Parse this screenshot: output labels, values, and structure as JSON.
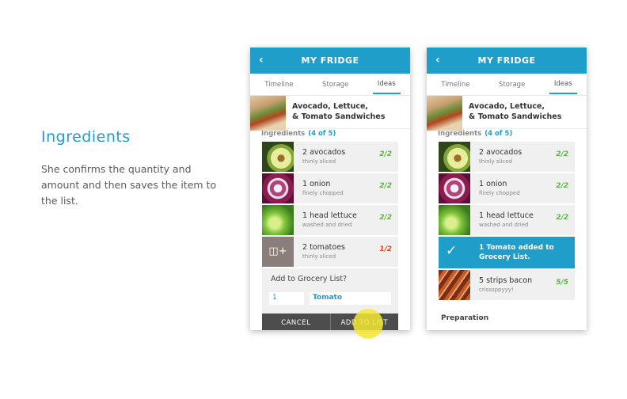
{
  "intro": {
    "title": "Ingredients",
    "description": "She confirms the quantity and amount and then saves the item to the list."
  },
  "app": {
    "title": "MY FRIDGE",
    "back_icon": "chevron-left-icon",
    "tabs": [
      "Timeline",
      "Storage",
      "Ideas"
    ],
    "active_tab": "Ideas",
    "recipe_title_line1": "Avocado, Lettuce,",
    "recipe_title_line2": "& Tomato Sandwiches",
    "ingredients_label": "Ingredients",
    "ingredients_count": "(4 of 5)"
  },
  "screen1": {
    "items": [
      {
        "name": "2 avocados",
        "sub": "thinly sliced",
        "frac": "2/2",
        "status": "full"
      },
      {
        "name": "1 onion",
        "sub": "finely chopped",
        "frac": "2/2",
        "status": "full"
      },
      {
        "name": "1 head lettuce",
        "sub": "washed and dried",
        "frac": "2/2",
        "status": "full"
      },
      {
        "name": "2 tomatoes",
        "sub": "thinly sliced",
        "frac": "1/2",
        "status": "low"
      }
    ],
    "add_prompt": "Add to Grocery List?",
    "qty_value": "1",
    "item_value": "Tomato",
    "cancel_label": "CANCEL",
    "add_label": "ADD TO LIST"
  },
  "screen2": {
    "items": [
      {
        "name": "2 avocados",
        "sub": "thinly sliced",
        "frac": "2/2",
        "status": "full"
      },
      {
        "name": "1 onion",
        "sub": "finely chopped",
        "frac": "2/2",
        "status": "full"
      },
      {
        "name": "1 head lettuce",
        "sub": "washed and dried",
        "frac": "2/2",
        "status": "full"
      },
      {
        "name": "5 strips bacon",
        "sub": "crisssppyyy!",
        "frac": "5/5",
        "status": "full"
      }
    ],
    "added_line1": "1 Tomato added to",
    "added_line2": "Grocery List.",
    "preparation_label": "Preparation"
  },
  "colors": {
    "accent": "#1f9ec9",
    "full": "#5bb346",
    "low": "#e4452f",
    "button": "#4d4d4d"
  }
}
